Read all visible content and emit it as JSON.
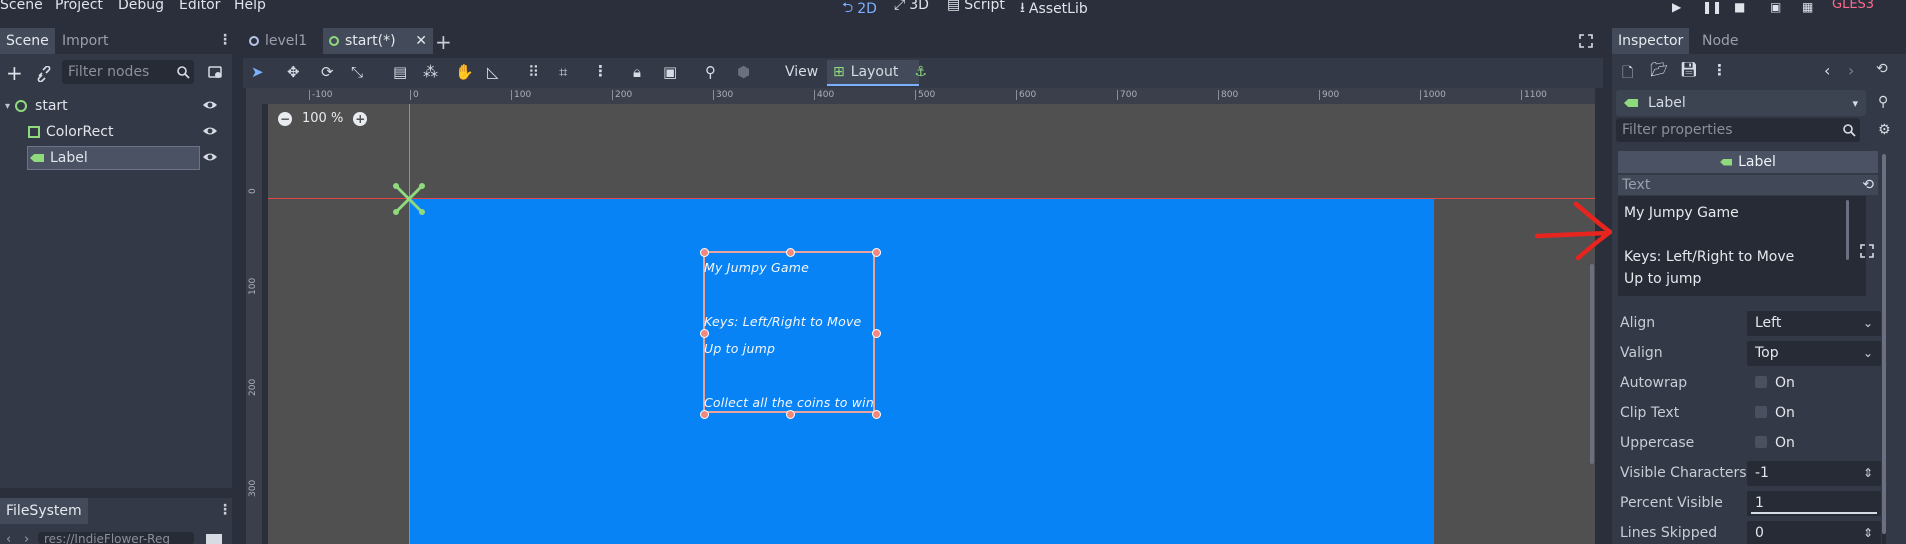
{
  "menu": {
    "items": [
      "Scene",
      "Project",
      "Debug",
      "Editor",
      "Help"
    ],
    "modes": [
      "2D",
      "3D",
      "Script",
      "AssetLib"
    ],
    "renderer": "GLES3"
  },
  "scene_panel": {
    "tabs": [
      "Scene",
      "Import"
    ],
    "filter_placeholder": "Filter nodes",
    "nodes": [
      {
        "label": "start",
        "depth": 0
      },
      {
        "label": "ColorRect",
        "depth": 1
      },
      {
        "label": "Label",
        "depth": 1
      }
    ]
  },
  "filesystem": {
    "tab": "FileSystem",
    "path": "res://IndieFlower-Reg"
  },
  "editor": {
    "tabs": [
      "level1",
      "start(*)"
    ],
    "toolbar": {
      "view_label": "View",
      "layout_label": "Layout"
    },
    "zoom": "100 %",
    "ruler_h_ticks": [
      "-100",
      "0",
      "100",
      "200",
      "300",
      "400",
      "500",
      "600",
      "700",
      "800",
      "900",
      "1000",
      "1100"
    ],
    "ruler_v_ticks": [
      "0",
      "100",
      "200",
      "300"
    ],
    "label_lines": [
      "My Jumpy  Game",
      "",
      "Keys: Left/Right to Move",
      "Up to jump",
      "",
      "Collect all the coins to win"
    ]
  },
  "inspector": {
    "tabs": [
      "Inspector",
      "Node"
    ],
    "node_type": "Label",
    "filter_placeholder": "Filter properties",
    "section_title": "Label",
    "text_label": "Text",
    "text_lines": [
      "My Jumpy  Game",
      "",
      "Keys: Left/Right to Move",
      "Up to jump"
    ],
    "props": [
      {
        "label": "Align",
        "value": "Left",
        "kind": "dropdown"
      },
      {
        "label": "Valign",
        "value": "Top",
        "kind": "dropdown"
      },
      {
        "label": "Autowrap",
        "value": "On",
        "kind": "check"
      },
      {
        "label": "Clip Text",
        "value": "On",
        "kind": "check"
      },
      {
        "label": "Uppercase",
        "value": "On",
        "kind": "check"
      },
      {
        "label": "Visible Characters",
        "value": "-1",
        "kind": "spin"
      },
      {
        "label": "Percent Visible",
        "value": "1",
        "kind": "slider"
      },
      {
        "label": "Lines Skipped",
        "value": "0",
        "kind": "spin"
      }
    ]
  },
  "colors": {
    "accent": "#7ab0ff",
    "canvas_blue": "#0783f5",
    "annotation_red": "#e8241f"
  }
}
